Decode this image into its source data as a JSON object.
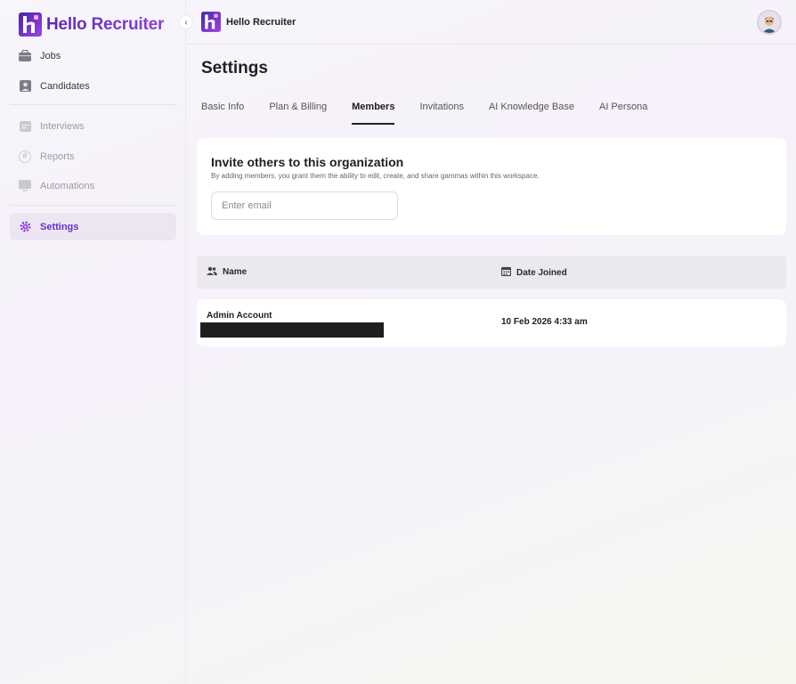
{
  "app": {
    "name": "Hello Recruiter"
  },
  "sidebar": {
    "items": [
      {
        "label": "Jobs",
        "icon": "briefcase-icon"
      },
      {
        "label": "Candidates",
        "icon": "user-icon"
      },
      {
        "label": "Interviews",
        "icon": "calendar-icon"
      },
      {
        "label": "Reports",
        "icon": "hash-icon"
      },
      {
        "label": "Automations",
        "icon": "monitor-icon"
      },
      {
        "label": "Settings",
        "icon": "gear-icon"
      }
    ]
  },
  "header": {
    "brand": "Hello Recruiter"
  },
  "page": {
    "title": "Settings"
  },
  "tabs": [
    "Basic Info",
    "Plan & Billing",
    "Members",
    "Invitations",
    "AI Knowledge Base",
    "AI Persona"
  ],
  "invite": {
    "title": "Invite others to this organization",
    "subtitle": "By adding members, you grant them the ability to edit, create, and share gammas within this workspace.",
    "email_placeholder": "Enter email"
  },
  "table": {
    "columns": [
      "Name",
      "Date Joined"
    ],
    "rows": [
      {
        "name": "Admin Account",
        "date_joined": "10 Feb 2026 4:33 am"
      }
    ]
  },
  "colors": {
    "accent": "#6a2fc4",
    "brand_gradient_start": "#5b2bb6",
    "brand_gradient_end": "#8b3fd9"
  }
}
